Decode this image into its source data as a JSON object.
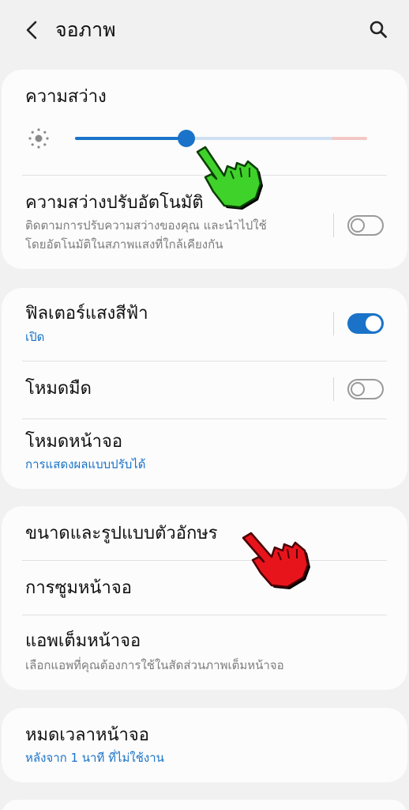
{
  "header": {
    "title": "จอภาพ",
    "back_icon": "chevron-left-icon",
    "search_icon": "search-icon"
  },
  "brightness": {
    "title": "ความสว่าง",
    "level": 0.38,
    "sun_icon": "sun-icon"
  },
  "adaptive_brightness": {
    "title": "ความสว่างปรับอัตโนมัติ",
    "desc_line1": "ติดตามการปรับความสว่างของคุณ และนำไปใช้",
    "desc_line2": "โดยอัตโนมัติในสภาพแสงที่ใกล้เคียงกัน",
    "enabled": false
  },
  "blue_light": {
    "title": "ฟิลเตอร์แสงสีฟ้า",
    "status": "เปิด",
    "enabled": true
  },
  "dark_mode": {
    "title": "โหมดมืด",
    "enabled": false
  },
  "screen_mode": {
    "title": "โหมดหน้าจอ",
    "value": "การแสดงผลแบบปรับได้"
  },
  "font": {
    "title": "ขนาดและรูปแบบตัวอักษร"
  },
  "screen_zoom": {
    "title": "การซูมหน้าจอ"
  },
  "full_screen_apps": {
    "title": "แอพเต็มหน้าจอ",
    "desc": "เลือกแอพที่คุณต้องการใช้ในสัดส่วนภาพเต็มหน้าจอ"
  },
  "screen_timeout": {
    "title": "หมดเวลาหน้าจอ",
    "value": "หลังจาก 1 นาที ที่ไม่ใช้งาน"
  },
  "colors": {
    "accent": "#1a73c8",
    "background": "#f1f1f1",
    "card": "#fcfcfc",
    "green_hand": "#3fd22a",
    "red_hand": "#e8141c"
  }
}
